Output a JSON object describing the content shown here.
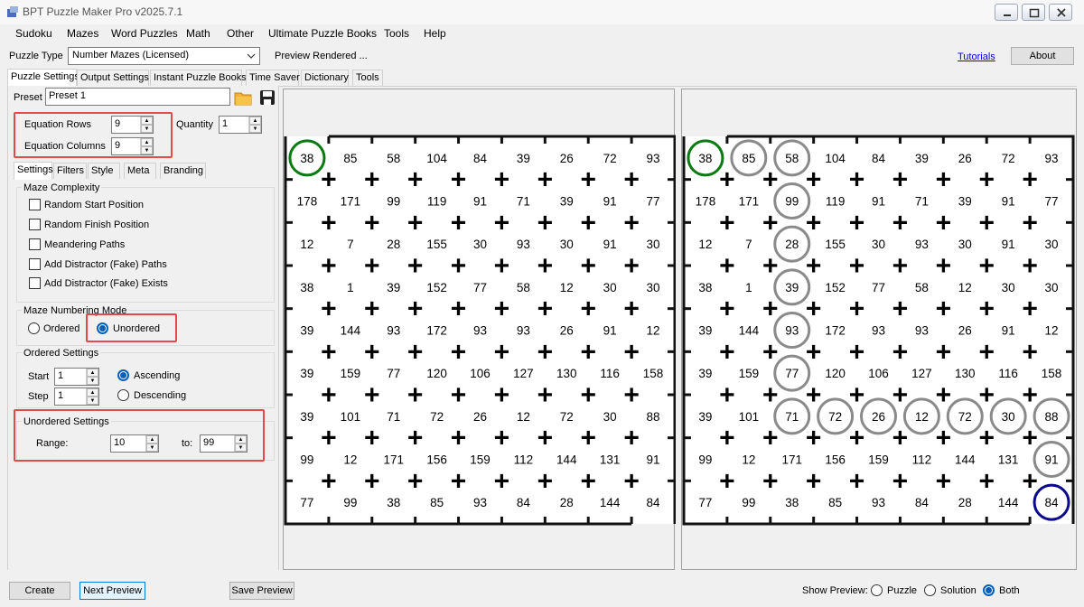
{
  "window": {
    "title": "BPT Puzzle Maker Pro v2025.7.1"
  },
  "menu": [
    "Sudoku",
    "Mazes",
    "Word Puzzles",
    "Math",
    "Other",
    "Ultimate Puzzle Books",
    "Tools",
    "Help"
  ],
  "puzzle_type": {
    "label": "Puzzle Type",
    "value": "Number Mazes (Licensed)",
    "status": "Preview Rendered ...",
    "tutorials": "Tutorials",
    "about": "About"
  },
  "main_tabs": [
    "Puzzle Settings",
    "Output Settings",
    "Instant Puzzle Books",
    "Time Saver",
    "Dictionary",
    "Tools"
  ],
  "preset": {
    "label": "Preset",
    "value": "Preset 1"
  },
  "equation": {
    "rows_label": "Equation Rows",
    "rows": "9",
    "cols_label": "Equation Columns",
    "cols": "9",
    "quantity_label": "Quantity",
    "quantity": "1"
  },
  "sub_tabs": [
    "Settings",
    "Filters",
    "Style",
    "Meta",
    "Branding"
  ],
  "maze_complexity": {
    "title": "Maze Complexity",
    "options": [
      "Random Start Position",
      "Random Finish Position",
      "Meandering Paths",
      "Add Distractor (Fake) Paths",
      "Add Distractor (Fake) Exists"
    ]
  },
  "numbering_mode": {
    "title": "Maze Numbering Mode",
    "ordered": "Ordered",
    "unordered": "Unordered",
    "selected": "Unordered"
  },
  "ordered_settings": {
    "title": "Ordered Settings",
    "start_label": "Start",
    "start": "1",
    "step_label": "Step",
    "step": "1",
    "ascending": "Ascending",
    "descending": "Descending",
    "selected": "Ascending"
  },
  "unordered_settings": {
    "title": "Unordered Settings",
    "range_label": "Range:",
    "from": "10",
    "to_label": "to:",
    "to": "99"
  },
  "grid": [
    [
      38,
      85,
      58,
      104,
      84,
      39,
      26,
      72,
      93
    ],
    [
      178,
      171,
      99,
      119,
      91,
      71,
      39,
      91,
      77
    ],
    [
      12,
      7,
      28,
      155,
      30,
      93,
      30,
      91,
      30
    ],
    [
      38,
      1,
      39,
      152,
      77,
      58,
      12,
      30,
      30
    ],
    [
      39,
      144,
      93,
      172,
      93,
      93,
      26,
      91,
      12
    ],
    [
      39,
      159,
      77,
      120,
      106,
      127,
      130,
      116,
      158
    ],
    [
      39,
      101,
      71,
      72,
      26,
      12,
      72,
      30,
      88
    ],
    [
      99,
      12,
      171,
      156,
      159,
      112,
      144,
      131,
      91
    ],
    [
      77,
      99,
      38,
      85,
      93,
      84,
      28,
      144,
      84
    ]
  ],
  "operator": "+",
  "solution_path": [
    [
      0,
      0
    ],
    [
      0,
      1
    ],
    [
      0,
      2
    ],
    [
      1,
      2
    ],
    [
      2,
      2
    ],
    [
      3,
      2
    ],
    [
      4,
      2
    ],
    [
      5,
      2
    ],
    [
      6,
      2
    ],
    [
      6,
      3
    ],
    [
      6,
      4
    ],
    [
      6,
      5
    ],
    [
      6,
      6
    ],
    [
      6,
      7
    ],
    [
      6,
      8
    ],
    [
      7,
      8
    ],
    [
      8,
      8
    ]
  ],
  "colors": {
    "start": "#0a7a12",
    "finish": "#0a0a8a",
    "path": "#8a8a8a",
    "highlight": "#e44a4a",
    "accent": "#005fb8"
  },
  "bottom": {
    "create": "Create",
    "next_preview": "Next Preview",
    "save_preview": "Save Preview",
    "show_preview_label": "Show Preview:",
    "puzzle": "Puzzle",
    "solution": "Solution",
    "both": "Both",
    "selected": "Both"
  }
}
